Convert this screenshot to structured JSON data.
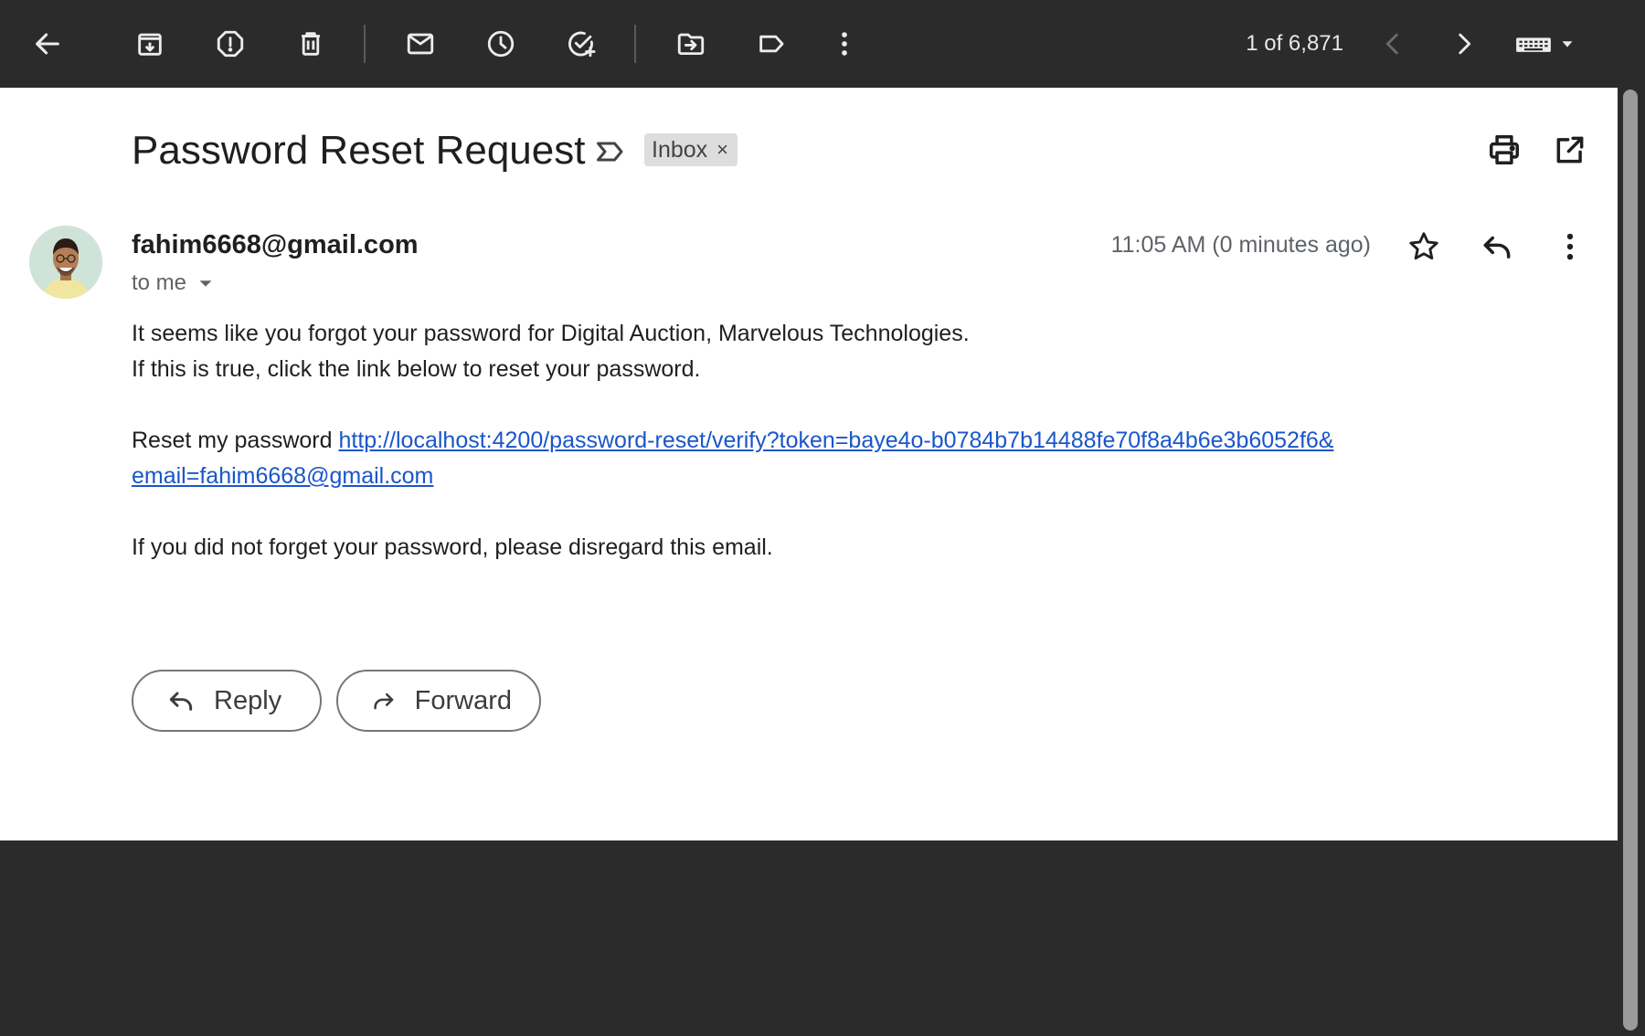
{
  "toolbar": {
    "icons": [
      "back-arrow-icon",
      "archive-icon",
      "report-spam-icon",
      "delete-icon",
      "mark-unread-icon",
      "snooze-icon",
      "add-to-tasks-icon",
      "move-to-icon",
      "labels-icon",
      "more-vert-icon"
    ],
    "pager": "1 of 6,871",
    "pager_icons": [
      "chevron-left-icon",
      "chevron-right-icon"
    ],
    "input_tools": "keyboard-icon"
  },
  "email": {
    "subject": "Password Reset Request",
    "label": "Inbox",
    "label_remove": "×",
    "sender": "fahim6668@gmail.com",
    "to": "to me",
    "time": "11:05 AM (0 minutes ago)",
    "body": {
      "line1": "It seems like you forgot your password for Digital Auction, Marvelous Technologies.",
      "line2": "If this is true, click the link below to reset your password.",
      "reset_prefix": "Reset my password ",
      "reset_link_part1": "http://localhost:4200/password-reset/verify?token=baye4o-b0784b7b14488fe70f8a4b6e3b6052f6&",
      "reset_link_part2": "email=fahim6668@gmail.com",
      "line4": "If you did not forget your password, please disregard this email."
    }
  },
  "actions": {
    "reply": "Reply",
    "forward": "Forward"
  },
  "colors": {
    "toolbar_bg": "#2b2b2b",
    "content_bg": "#ffffff",
    "link": "#1a56c9",
    "label_chip": "#dddddd"
  }
}
